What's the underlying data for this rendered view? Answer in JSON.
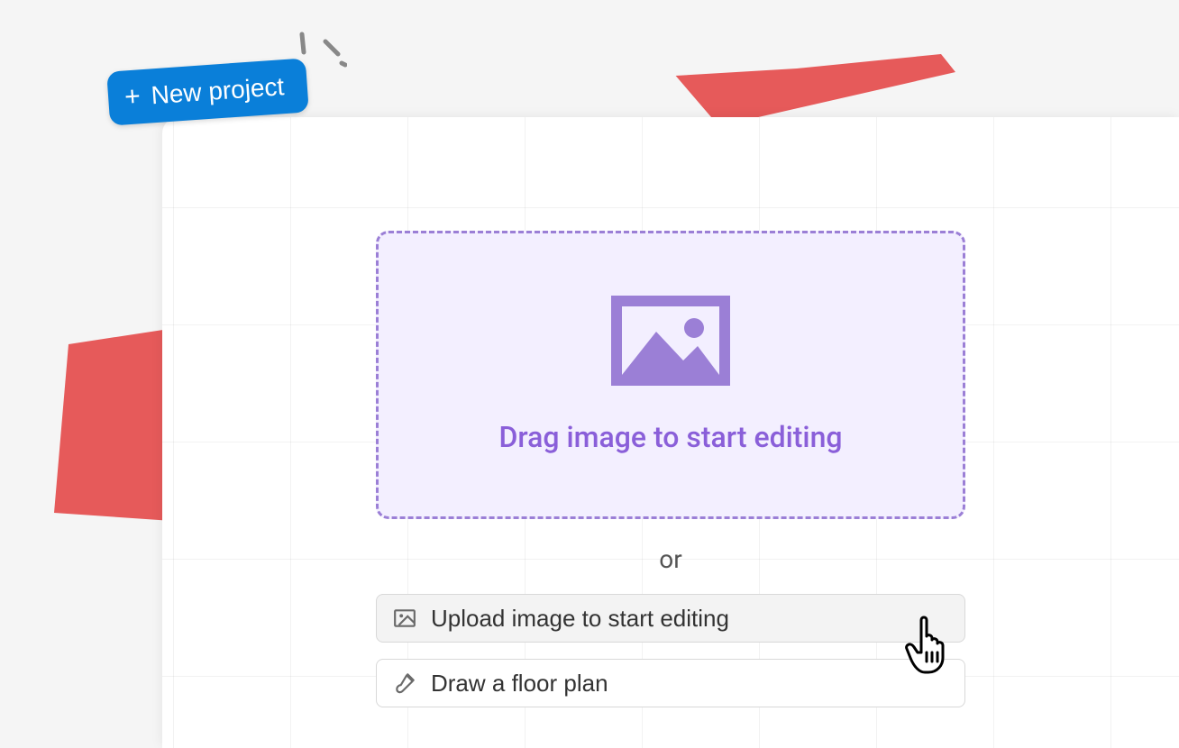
{
  "new_project": {
    "label": "New project"
  },
  "dropzone": {
    "text": "Drag image to start editing"
  },
  "separator": "or",
  "options": {
    "upload_label": "Upload image to start editing",
    "draw_label": "Draw a floor plan"
  }
}
